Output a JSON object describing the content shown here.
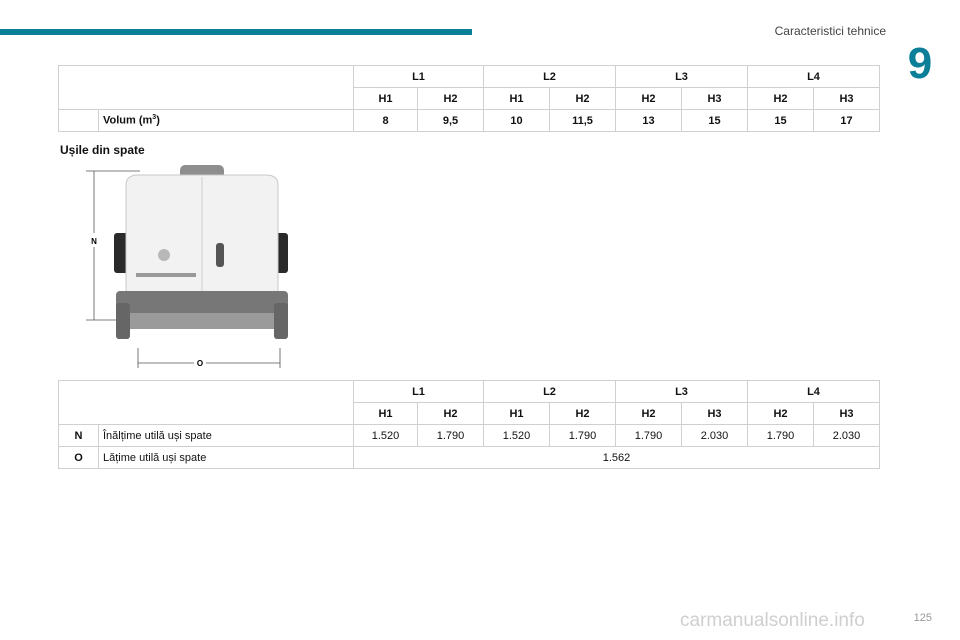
{
  "header": {
    "section_title": "Caracteristici tehnice",
    "chapter_number": "9"
  },
  "volume_table": {
    "lengths": [
      "L1",
      "L2",
      "L3",
      "L4"
    ],
    "heights": [
      "H1",
      "H2",
      "H1",
      "H2",
      "H2",
      "H3",
      "H2",
      "H3"
    ],
    "row_label": "Volum (m",
    "row_label_sup": "3",
    "row_label_end": ")",
    "values": [
      "8",
      "9,5",
      "10",
      "11,5",
      "13",
      "15",
      "15",
      "17"
    ]
  },
  "doors_heading": "Ușile din spate",
  "illustration": {
    "height_marker": "N",
    "width_marker": "O"
  },
  "doors_table": {
    "lengths": [
      "L1",
      "L2",
      "L3",
      "L4"
    ],
    "heights": [
      "H1",
      "H2",
      "H1",
      "H2",
      "H2",
      "H3",
      "H2",
      "H3"
    ],
    "row_n": {
      "code": "N",
      "label": "Înălțime utilă uși spate",
      "values": [
        "1.520",
        "1.790",
        "1.520",
        "1.790",
        "1.790",
        "2.030",
        "1.790",
        "2.030"
      ]
    },
    "row_o": {
      "code": "O",
      "label": "Lățime utilă uși spate",
      "value": "1.562"
    }
  },
  "footer": {
    "page_number": "125",
    "watermark": "carmanualsonline.info"
  }
}
